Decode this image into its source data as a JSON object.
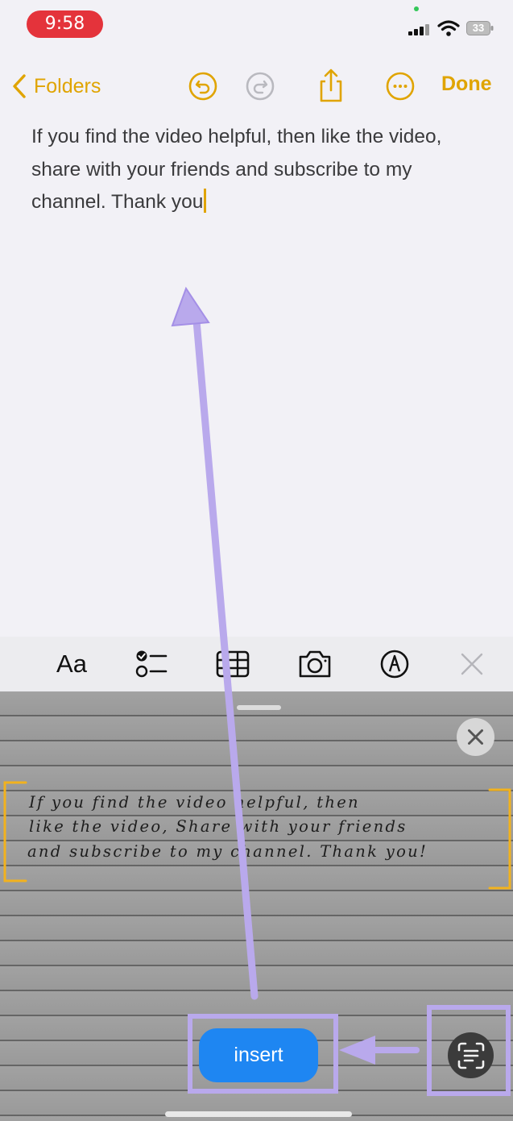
{
  "status_bar": {
    "time": "9:58",
    "battery": "33"
  },
  "toolbar": {
    "back_label": "Folders",
    "done_label": "Done"
  },
  "note": {
    "lines": [
      "If you find the video helpful, then like the video,",
      "share with your friends and subscribe to my",
      "channel. Thank you"
    ]
  },
  "format_bar": {
    "text_style_label": "Aa"
  },
  "camera": {
    "handwriting_lines": [
      "If you find the video helpful, then",
      "like the video, Share with your friends",
      "and subscribe to my channel. Thank you!"
    ],
    "insert_label": "insert"
  },
  "colors": {
    "accent": "#e0a400",
    "insert_blue": "#1e86f2",
    "annotation_purple": "#b9a9ec",
    "status_red": "#e4333b"
  }
}
